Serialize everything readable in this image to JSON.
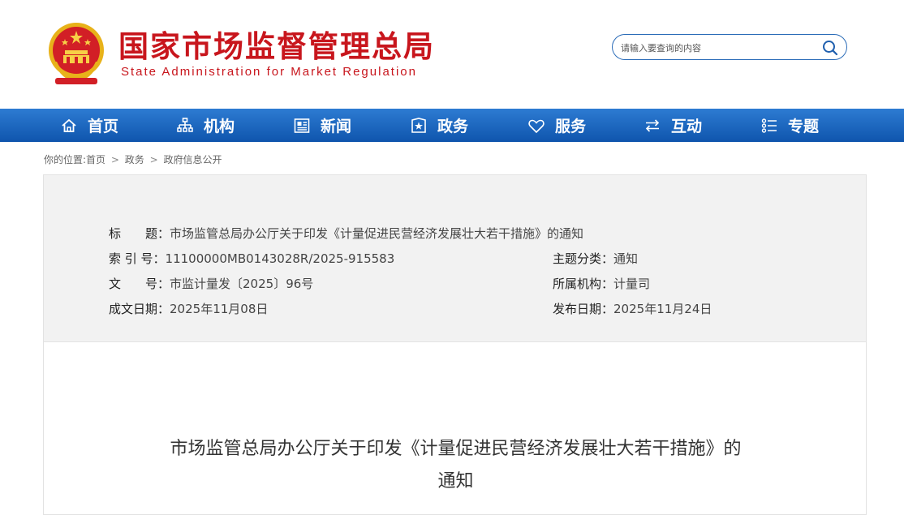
{
  "site": {
    "title": "国家市场监督管理总局",
    "subtitle": "State Administration for Market Regulation"
  },
  "search": {
    "placeholder": "请输入要查询的内容"
  },
  "nav": {
    "items": [
      {
        "label": "首页",
        "icon": "home-icon"
      },
      {
        "label": "机构",
        "icon": "org-chart-icon"
      },
      {
        "label": "新闻",
        "icon": "newspaper-icon"
      },
      {
        "label": "政务",
        "icon": "shield-star-icon"
      },
      {
        "label": "服务",
        "icon": "heart-icon"
      },
      {
        "label": "互动",
        "icon": "exchange-arrows-icon"
      },
      {
        "label": "专题",
        "icon": "list-icon"
      }
    ]
  },
  "breadcrumb": {
    "prefix": "你的位置:",
    "items": [
      "首页",
      "政务",
      "政府信息公开"
    ],
    "separator": ">"
  },
  "meta": {
    "title_key": "标　　题：",
    "title_val": "市场监管总局办公厅关于印发《计量促进民营经济发展壮大若干措施》的通知",
    "index_key": "索 引 号：",
    "index_val": "11100000MB0143028R/2025-915583",
    "category_key": "主题分类：",
    "category_val": "通知",
    "docno_key": "文　　号：",
    "docno_val": "市监计量发〔2025〕96号",
    "org_key": "所属机构：",
    "org_val": "计量司",
    "created_key": "成文日期：",
    "created_val": "2025年11月08日",
    "published_key": "发布日期：",
    "published_val": "2025年11月24日"
  },
  "article": {
    "title_line1": "市场监管总局办公厅关于印发《计量促进民营经济发展壮大若干措施》的",
    "title_line2": "通知"
  },
  "colors": {
    "brand_red": "#c8161d",
    "nav_blue": "#1565c0",
    "search_border": "#2b6cb8"
  }
}
